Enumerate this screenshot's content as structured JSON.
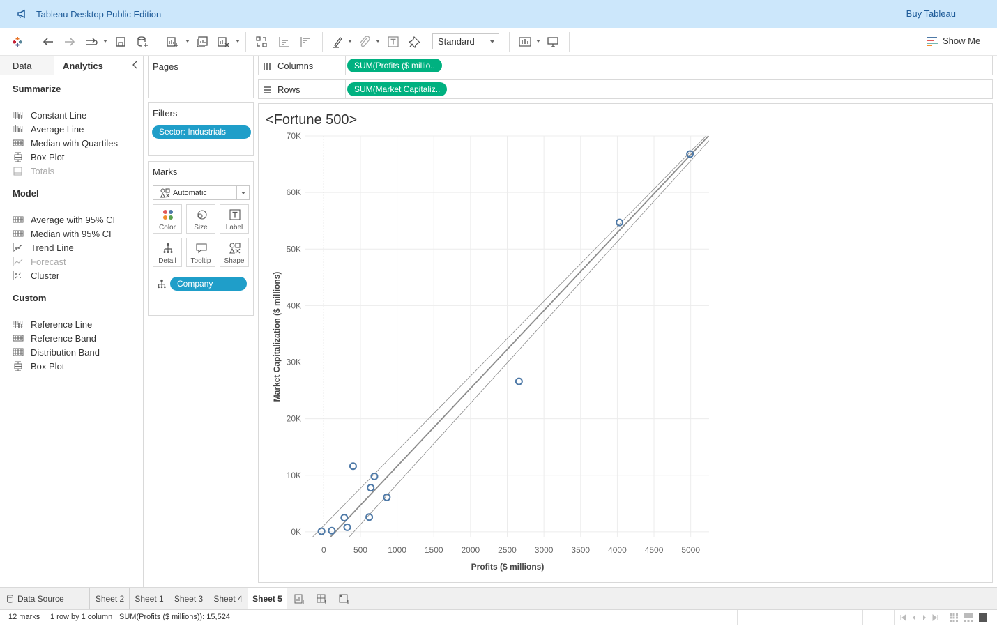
{
  "app": {
    "title": "Tableau Desktop Public Edition",
    "buy_label": "Buy Tableau"
  },
  "toolbar": {
    "fit_value": "Standard",
    "show_me_label": "Show Me"
  },
  "left_panel": {
    "tabs": {
      "data": "Data",
      "analytics": "Analytics"
    },
    "sections": [
      {
        "title": "Summarize",
        "items": [
          {
            "label": "Constant Line",
            "icon": "reference-line-icon",
            "enabled": true
          },
          {
            "label": "Average Line",
            "icon": "reference-line-icon",
            "enabled": true
          },
          {
            "label": "Median with Quartiles",
            "icon": "band-icon",
            "enabled": true
          },
          {
            "label": "Box Plot",
            "icon": "box-plot-icon",
            "enabled": true
          },
          {
            "label": "Totals",
            "icon": "totals-icon",
            "enabled": false
          }
        ]
      },
      {
        "title": "Model",
        "items": [
          {
            "label": "Average with 95% CI",
            "icon": "band-icon",
            "enabled": true
          },
          {
            "label": "Median with 95% CI",
            "icon": "band-icon",
            "enabled": true
          },
          {
            "label": "Trend Line",
            "icon": "trend-line-icon",
            "enabled": true
          },
          {
            "label": "Forecast",
            "icon": "forecast-icon",
            "enabled": false
          },
          {
            "label": "Cluster",
            "icon": "cluster-icon",
            "enabled": true
          }
        ]
      },
      {
        "title": "Custom",
        "items": [
          {
            "label": "Reference Line",
            "icon": "reference-line-icon",
            "enabled": true
          },
          {
            "label": "Reference Band",
            "icon": "band-icon",
            "enabled": true
          },
          {
            "label": "Distribution Band",
            "icon": "distribution-band-icon",
            "enabled": true
          },
          {
            "label": "Box Plot",
            "icon": "box-plot-icon",
            "enabled": true
          }
        ]
      }
    ]
  },
  "cards": {
    "pages": {
      "title": "Pages"
    },
    "filters": {
      "title": "Filters",
      "pill": "Sector: Industrials"
    },
    "marks": {
      "title": "Marks",
      "mark_type": "Automatic",
      "buttons": [
        "Color",
        "Size",
        "Label",
        "Detail",
        "Tooltip",
        "Shape"
      ],
      "detail_pill": "Company"
    }
  },
  "shelves": {
    "columns": {
      "label": "Columns",
      "pill": "SUM(Profits ($ millio.."
    },
    "rows": {
      "label": "Rows",
      "pill": "SUM(Market Capitaliz.."
    }
  },
  "viz": {
    "title": "<Fortune 500>"
  },
  "chart_data": {
    "type": "scatter",
    "title": "<Fortune 500>",
    "xlabel": "Profits ($ millions)",
    "ylabel": "Market Capitalization ($ millions)",
    "xlim": [
      -250,
      5250
    ],
    "ylim": [
      -1000,
      70000
    ],
    "x_ticks": [
      0,
      500,
      1000,
      1500,
      2000,
      2500,
      3000,
      3500,
      4000,
      4500,
      5000
    ],
    "x_tick_labels": [
      "0",
      "500",
      "1000",
      "1500",
      "2000",
      "2500",
      "3000",
      "3500",
      "4000",
      "4500",
      "5000"
    ],
    "y_ticks": [
      0,
      10000,
      20000,
      30000,
      40000,
      50000,
      60000,
      70000
    ],
    "y_tick_labels": [
      "0K",
      "10K",
      "20K",
      "30K",
      "40K",
      "50K",
      "60K",
      "70K"
    ],
    "grid": true,
    "points": [
      {
        "x": -30,
        "y": 100
      },
      {
        "x": 110,
        "y": 200
      },
      {
        "x": 280,
        "y": 2500
      },
      {
        "x": 320,
        "y": 800
      },
      {
        "x": 400,
        "y": 11600
      },
      {
        "x": 620,
        "y": 2600
      },
      {
        "x": 640,
        "y": 7800
      },
      {
        "x": 690,
        "y": 9800
      },
      {
        "x": 860,
        "y": 6100
      },
      {
        "x": 2660,
        "y": 26600
      },
      {
        "x": 4030,
        "y": 54700
      },
      {
        "x": 4990,
        "y": 66800
      }
    ],
    "trend_line": {
      "slope": 13.77,
      "intercept": -2180
    },
    "confidence_bands": [
      {
        "slope": 13.23,
        "intercept": 1090
      },
      {
        "slope": 14.29,
        "intercept": -5850
      }
    ],
    "colors": {
      "marks": "#4e79a7",
      "trend": "#8c8c8c"
    }
  },
  "sheets": {
    "data_source": "Data Source",
    "tabs": [
      "Sheet 2",
      "Sheet 1",
      "Sheet 3",
      "Sheet 4",
      "Sheet 5"
    ],
    "active": "Sheet 5"
  },
  "status": {
    "marks": "12 marks",
    "dims": "1 row by 1 column",
    "sum": "SUM(Profits ($ millions)): 15,524"
  }
}
